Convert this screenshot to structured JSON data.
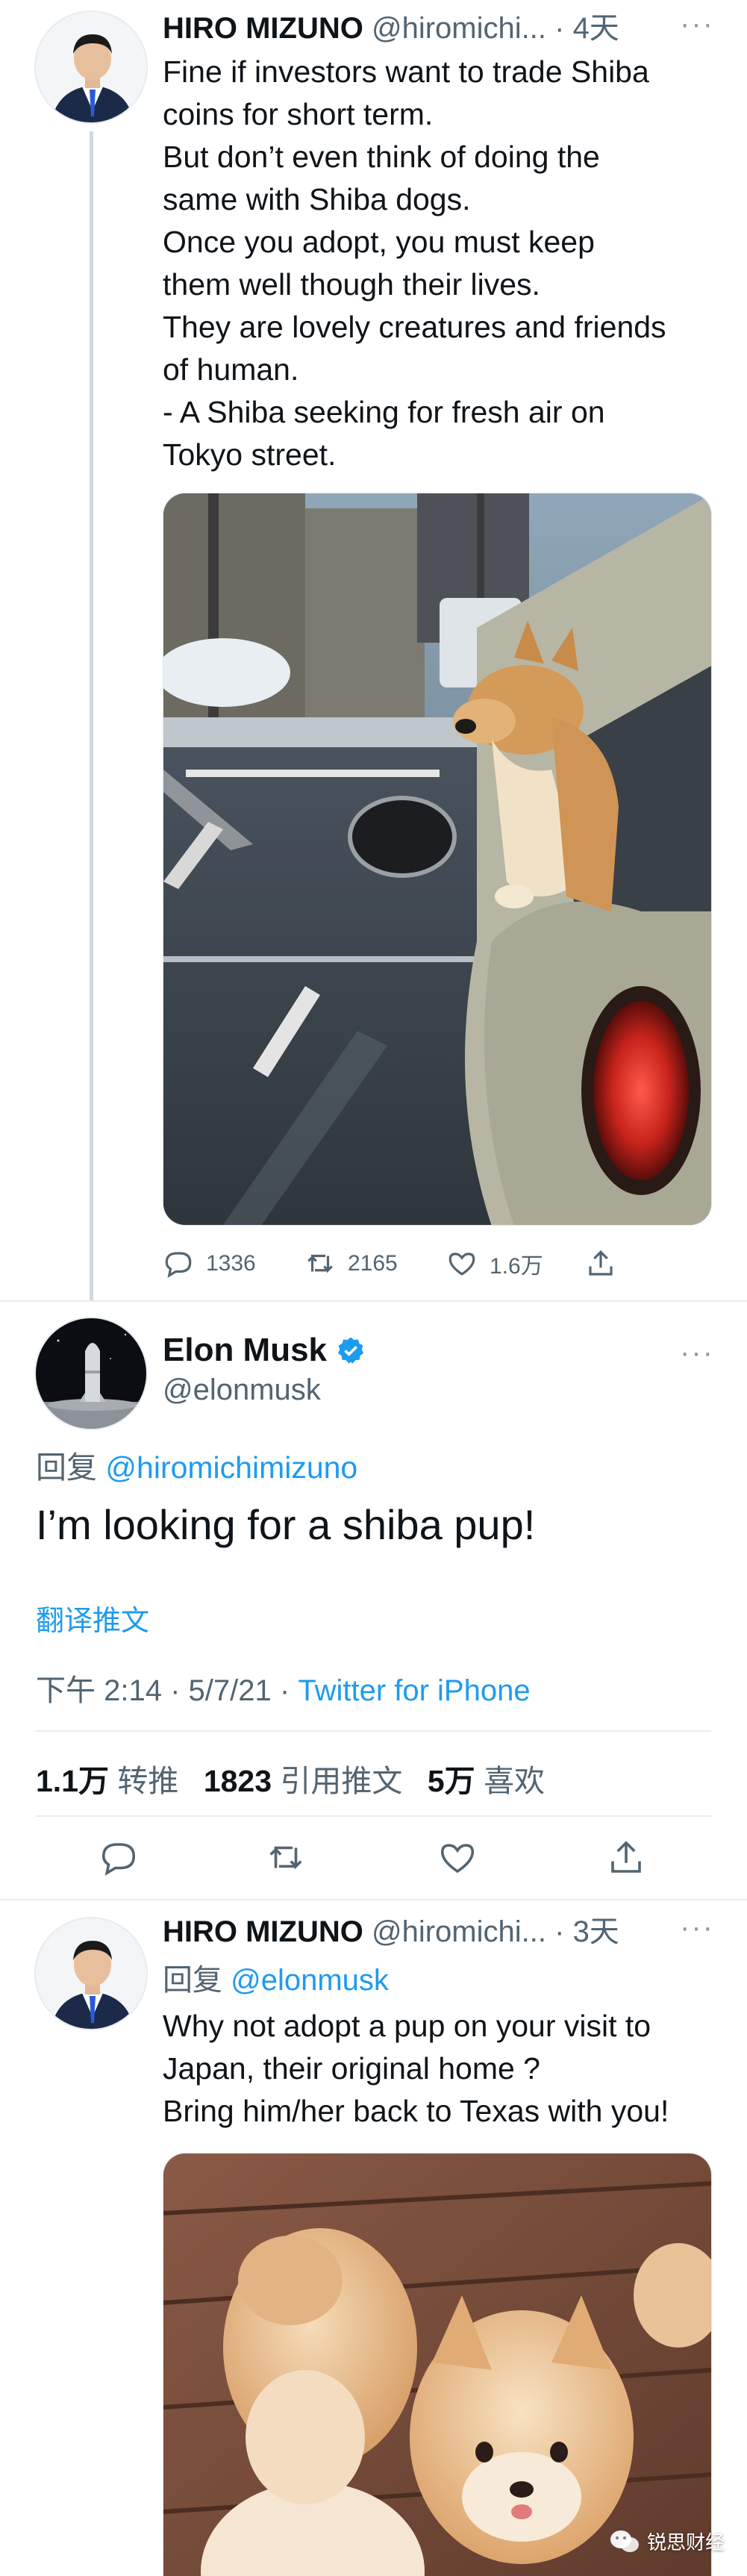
{
  "tweet1": {
    "name": "HIRO MIZUNO",
    "handle": "@hiromichi...",
    "separator": "·",
    "time": "4天",
    "more": "···",
    "lines": [
      "Fine if investors want to trade Shiba",
      "coins for short term.",
      "But don’t even think of doing the",
      "same with Shiba dogs.",
      "Once you adopt, you must keep",
      "them well though their lives.",
      "They are lovely creatures and friends",
      "of human.",
      "- A Shiba seeking for fresh air on",
      "Tokyo street."
    ],
    "actions": {
      "replies": "1336",
      "retweets": "2165",
      "likes": "1.6万"
    }
  },
  "tweet2": {
    "name": "Elon Musk",
    "handle": "@elonmusk",
    "more": "···",
    "reply_prefix": "回复",
    "reply_to": "@hiromichimizuno",
    "text": "I’m looking for a shiba pup!",
    "translate": "翻译推文",
    "time": "下午 2:14",
    "dot1": "·",
    "date": "5/7/21",
    "dot2": "·",
    "source": "Twitter for iPhone",
    "stats": {
      "retweets_value": "1.1万",
      "retweets_label": "转推",
      "quotes_value": "1823",
      "quotes_label": "引用推文",
      "likes_value": "5万",
      "likes_label": "喜欢"
    }
  },
  "tweet3": {
    "name": "HIRO MIZUNO",
    "handle": "@hiromichi...",
    "separator": "·",
    "time": "3天",
    "more": "···",
    "reply_prefix": "回复",
    "reply_to": "@elonmusk",
    "lines": [
      "Why not adopt a pup on your visit to",
      "Japan, their original home ?",
      "Bring him/her back to Texas with you!"
    ]
  },
  "watermark": {
    "text": "锐思财经"
  },
  "colors": {
    "accent": "#1d9bf0",
    "text": "#0f1419",
    "muted": "#536471",
    "verified": "#1d9bf0"
  },
  "icons": [
    "reply-icon",
    "retweet-icon",
    "like-icon",
    "share-icon",
    "verified-badge-icon",
    "more-icon",
    "wechat-icon"
  ]
}
